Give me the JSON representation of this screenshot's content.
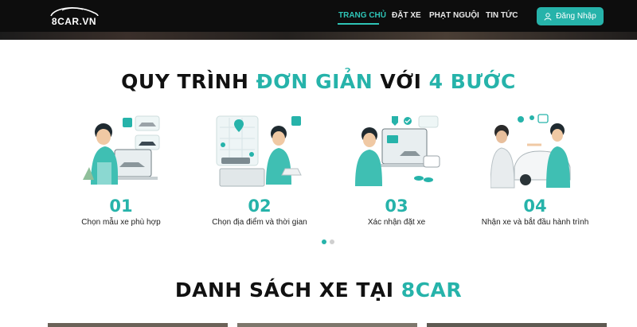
{
  "header": {
    "logo_text": "8CAR.VN",
    "nav": [
      {
        "label": "TRANG CHỦ",
        "active": true
      },
      {
        "label": "ĐẶT XE",
        "active": false
      },
      {
        "label": "PHẠT NGUỘI",
        "active": false
      },
      {
        "label": "TIN TỨC",
        "active": false
      }
    ],
    "login_label": "Đăng Nhập",
    "login_icon": "user-icon"
  },
  "process": {
    "title_part1": "QUY TRÌNH ",
    "title_accent1": "ĐƠN GIẢN",
    "title_part2": " VỚI ",
    "title_accent2": "4 BƯỚC",
    "steps": [
      {
        "number": "01",
        "label": "Chọn mẫu xe phù hợp"
      },
      {
        "number": "02",
        "label": "Chọn địa điểm và thời gian"
      },
      {
        "number": "03",
        "label": "Xác nhận đặt xe"
      },
      {
        "number": "04",
        "label": "Nhận xe và bắt đầu hành trình"
      }
    ],
    "carousel_dots": 2,
    "active_dot": 0
  },
  "car_list": {
    "title_part1": "DANH SÁCH XE TẠI ",
    "title_accent": "8CAR"
  },
  "colors": {
    "accent": "#26b3aa",
    "header_bg": "#0d0d0d"
  }
}
